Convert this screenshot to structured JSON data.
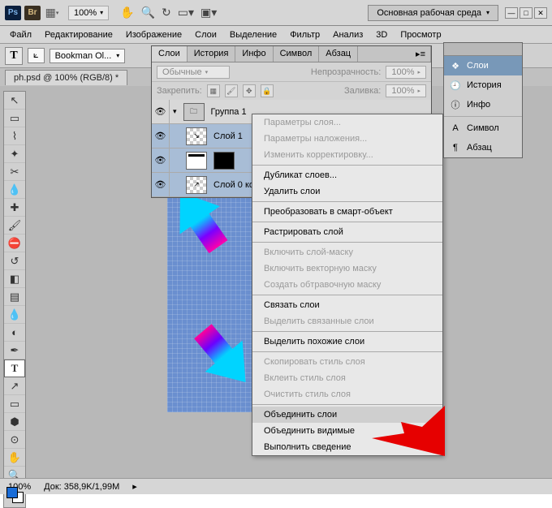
{
  "titlebar": {
    "ps": "Ps",
    "br": "Br",
    "zoom": "100%",
    "workspace": "Основная рабочая среда"
  },
  "menu": [
    "Файл",
    "Редактирование",
    "Изображение",
    "Слои",
    "Выделение",
    "Фильтр",
    "Анализ",
    "3D",
    "Просмотр"
  ],
  "options": {
    "font": "Bookman Ol..."
  },
  "doc_tab": "ph.psd @ 100% (RGB/8) *",
  "layers_panel": {
    "tabs": [
      "Слои",
      "История",
      "Инфо",
      "Символ",
      "Абзац"
    ],
    "mode_label": "Обычные",
    "opacity_label": "Непрозрачность:",
    "opacity_val": "100%",
    "lock_label": "Закрепить:",
    "fill_label": "Заливка:",
    "fill_val": "100%",
    "layers": [
      {
        "name": "Группа 1"
      },
      {
        "name": "Слой 1"
      },
      {
        "name": ""
      },
      {
        "name": "Слой 0 копи..."
      }
    ]
  },
  "context_menu": [
    {
      "t": "Параметры слоя...",
      "dis": true
    },
    {
      "t": "Параметры наложения...",
      "dis": true
    },
    {
      "t": "Изменить корректировку...",
      "dis": true
    },
    {
      "sep": true
    },
    {
      "t": "Дубликат слоев..."
    },
    {
      "t": "Удалить слои"
    },
    {
      "sep": true
    },
    {
      "t": "Преобразовать в смарт-объект"
    },
    {
      "sep": true
    },
    {
      "t": "Растрировать слой"
    },
    {
      "sep": true
    },
    {
      "t": "Включить слой-маску",
      "dis": true
    },
    {
      "t": "Включить векторную маску",
      "dis": true
    },
    {
      "t": "Создать обтравочную маску",
      "dis": true
    },
    {
      "sep": true
    },
    {
      "t": "Связать слои"
    },
    {
      "t": "Выделить связанные слои",
      "dis": true
    },
    {
      "sep": true
    },
    {
      "t": "Выделить похожие слои"
    },
    {
      "sep": true
    },
    {
      "t": "Скопировать стиль слоя",
      "dis": true
    },
    {
      "t": "Вклеить стиль слоя",
      "dis": true
    },
    {
      "t": "Очистить стиль слоя",
      "dis": true
    },
    {
      "sep": true
    },
    {
      "t": "Объединить слои",
      "hl": true
    },
    {
      "t": "Объединить видимые"
    },
    {
      "t": "Выполнить сведение"
    }
  ],
  "right_panel": [
    {
      "icon": "❖",
      "label": "Слои",
      "active": true
    },
    {
      "icon": "🕘",
      "label": "История"
    },
    {
      "icon": "ⓘ",
      "label": "Инфо"
    },
    {
      "sep": true
    },
    {
      "icon": "A",
      "label": "Символ"
    },
    {
      "icon": "¶",
      "label": "Абзац"
    }
  ],
  "status": {
    "zoom": "100%",
    "doc": "Док: 358,9K/1,99M"
  }
}
